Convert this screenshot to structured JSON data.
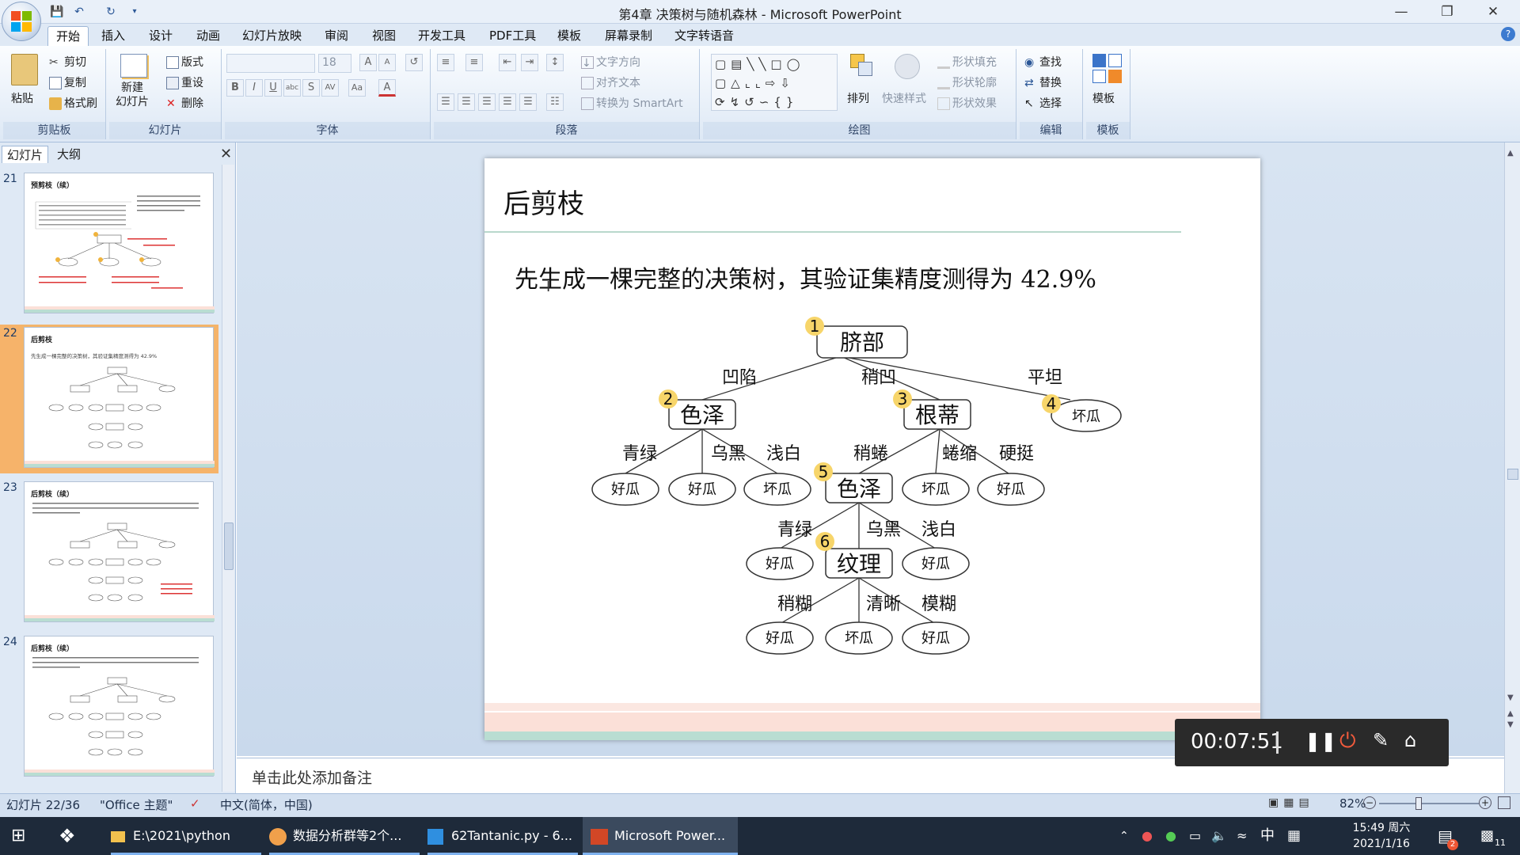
{
  "window": {
    "title": "第4章 决策树与随机森林 - Microsoft PowerPoint"
  },
  "ribbon_tabs": [
    "开始",
    "插入",
    "设计",
    "动画",
    "幻灯片放映",
    "审阅",
    "视图",
    "开发工具",
    "PDF工具",
    "模板",
    "屏幕录制",
    "文字转语音"
  ],
  "clipboard": {
    "paste": "粘贴",
    "cut": "剪切",
    "copy": "复制",
    "format_painter": "格式刷",
    "label": "剪贴板"
  },
  "slides_group": {
    "new_slide": "新建\n幻灯片",
    "layout": "版式",
    "reset": "重设",
    "delete": "删除",
    "label": "幻灯片"
  },
  "font_group": {
    "font_size": "18",
    "label": "字体"
  },
  "paragraph_group": {
    "text_direction": "文字方向",
    "align_text": "对齐文本",
    "smartart": "转换为 SmartArt",
    "label": "段落"
  },
  "drawing_group": {
    "arrange": "排列",
    "quick_styles": "快速样式",
    "fill": "形状填充",
    "outline": "形状轮廓",
    "effects": "形状效果",
    "label": "绘图"
  },
  "editing_group": {
    "find": "查找",
    "replace": "替换",
    "select": "选择",
    "label": "编辑"
  },
  "template_group": {
    "button": "模板",
    "label": "模板"
  },
  "panel_tabs": {
    "slides": "幻灯片",
    "outline": "大纲"
  },
  "thumbnails": [
    {
      "num": "21",
      "title": "预剪枝（续）"
    },
    {
      "num": "22",
      "title": "后剪枝",
      "text": "先生成一棵完整的决策树，其验证集精度测得为 42.9%"
    },
    {
      "num": "23",
      "title": "后剪枝（续）"
    },
    {
      "num": "24",
      "title": "后剪枝（续）"
    }
  ],
  "slide": {
    "title": "后剪枝",
    "body": "先生成一棵完整的决策树，其验证集精度测得为 42.9%",
    "tree": {
      "nodes": {
        "n1": "脐部",
        "n2": "色泽",
        "n3": "根蒂",
        "n5": "色泽",
        "n6": "纹理"
      },
      "marks": {
        "m1": "1",
        "m2": "2",
        "m3": "3",
        "m4": "4",
        "m5": "5",
        "m6": "6"
      },
      "edges": {
        "e1": "凹陷",
        "e2": "稍凹",
        "e3": "平坦",
        "e4": "青绿",
        "e5": "乌黑",
        "e6": "浅白",
        "e7": "稍蜷",
        "e8": "蜷缩",
        "e9": "硬挺",
        "e10": "青绿",
        "e11": "乌黑",
        "e12": "浅白",
        "e13": "稍糊",
        "e14": "清晰",
        "e15": "模糊"
      },
      "leaves": {
        "l4": "坏瓜",
        "l21": "好瓜",
        "l22": "好瓜",
        "l23": "坏瓜",
        "l32": "坏瓜",
        "l33": "好瓜",
        "l51": "好瓜",
        "l53": "好瓜",
        "l61": "好瓜",
        "l62": "坏瓜",
        "l63": "好瓜"
      }
    }
  },
  "notes": {
    "placeholder": "单击此处添加备注"
  },
  "recorder": {
    "time": "00:07:51"
  },
  "status": {
    "slide": "幻灯片 22/36",
    "theme": "\"Office 主题\"",
    "language": "中文(简体，中国)",
    "zoom": "82%"
  },
  "taskbar": {
    "items": [
      "E:\\2021\\python",
      "数据分析群等2个...",
      "62Tantanic.py - 6...",
      "Microsoft Power..."
    ],
    "ime": "中",
    "time": "15:49 周六",
    "date": "2021/1/16",
    "notif": "11"
  }
}
